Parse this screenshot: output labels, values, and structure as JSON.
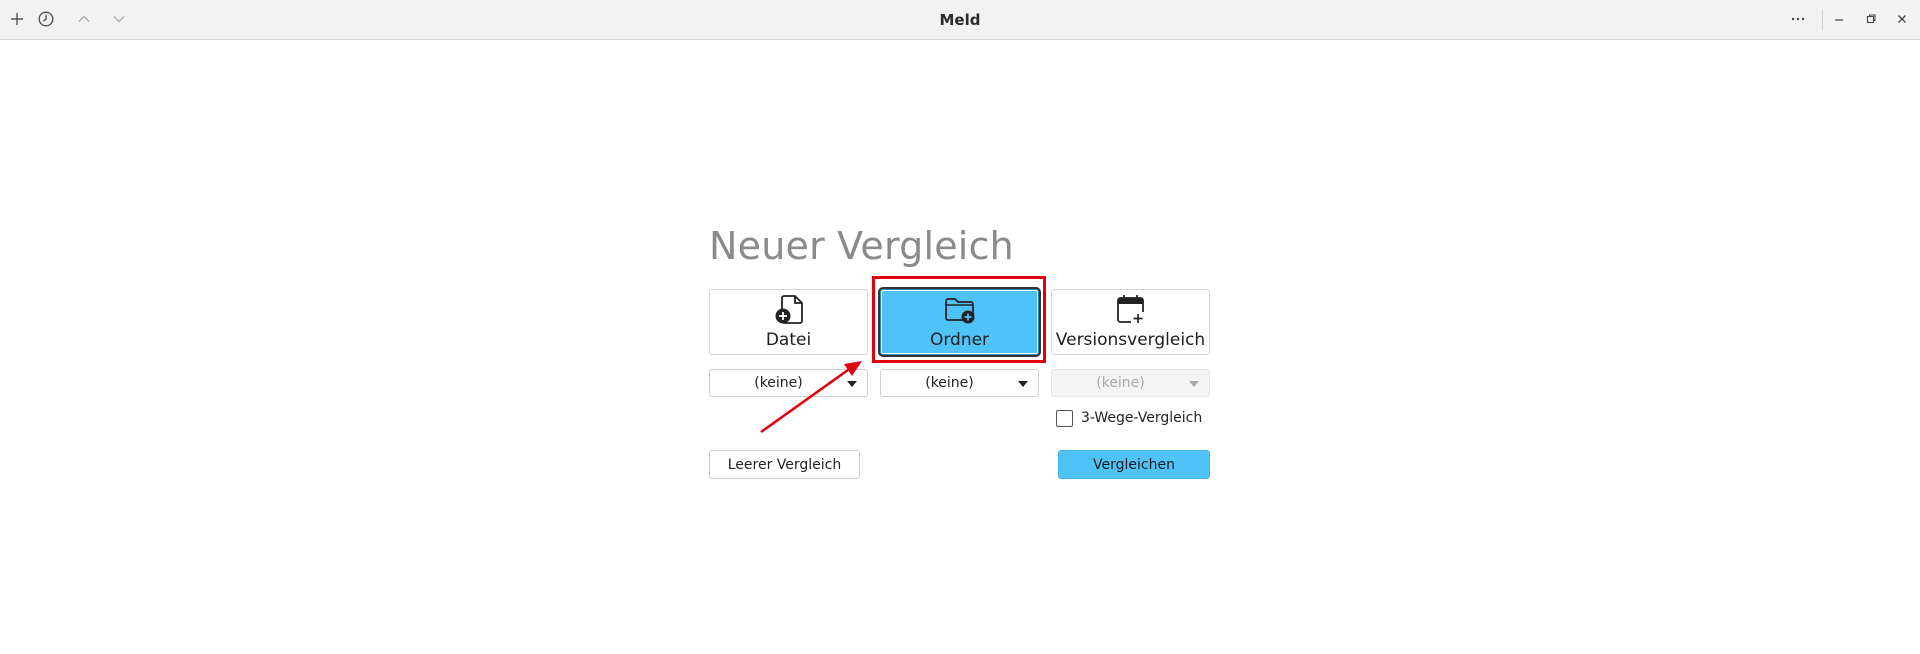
{
  "window": {
    "title": "Meld"
  },
  "titlebar": {
    "icons": [
      "plus-icon",
      "history-icon",
      "chevron-up-icon",
      "chevron-down-icon",
      "more-icon",
      "minimize-icon",
      "restore-icon",
      "close-icon"
    ]
  },
  "main": {
    "heading": "Neuer Vergleich",
    "types": [
      {
        "label": "Datei",
        "icon": "file-add-icon",
        "active": false
      },
      {
        "label": "Ordner",
        "icon": "folder-add-icon",
        "active": true
      },
      {
        "label": "Versionsvergleich",
        "icon": "calendar-add-icon",
        "active": false
      }
    ],
    "selectors": [
      {
        "value": "(keine)",
        "enabled": true
      },
      {
        "value": "(keine)",
        "enabled": true
      },
      {
        "value": "(keine)",
        "enabled": false
      }
    ],
    "three_way_label": "3-Wege-Vergleich",
    "three_way_checked": false,
    "blank_button": "Leerer Vergleich",
    "compare_button": "Vergleichen"
  },
  "annotation": {
    "highlight_color": "#e0000f",
    "accent_color": "#4fc3f7"
  }
}
